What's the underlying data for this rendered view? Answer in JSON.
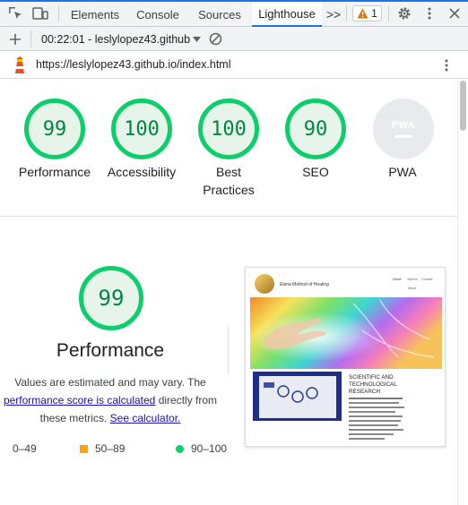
{
  "devtools": {
    "tabs": [
      "Elements",
      "Console",
      "Sources",
      "Lighthouse"
    ],
    "active_tab": "Lighthouse",
    "more_tabs": ">>",
    "warning_count": "1"
  },
  "toolbar": {
    "report_label": "00:22:01 - leslylopez43.github"
  },
  "url": "https://leslylopez43.github.io/index.html",
  "scores": [
    {
      "label": "Performance",
      "score": "99"
    },
    {
      "label": "Accessibility",
      "score": "100"
    },
    {
      "label": "Best",
      "label2": "Practices",
      "score": "100"
    },
    {
      "label": "SEO",
      "score": "90"
    },
    {
      "label": "PWA",
      "score": "PWA"
    }
  ],
  "performance": {
    "score": "99",
    "title": "Performance",
    "desc_line1": "Values are estimated and may vary. The",
    "desc_link1": "performance score is calculated",
    "desc_mid": "directly from",
    "desc_line3": "these metrics.",
    "desc_link2": "See calculator."
  },
  "legend": [
    {
      "range": "0–49",
      "color": "#ff4e42"
    },
    {
      "range": "50–89",
      "color": "#ffa400"
    },
    {
      "range": "90–100",
      "color": "#0cce6b"
    }
  ],
  "screenshot": {
    "site_title": "Elena Method of Healing",
    "nav": [
      "Home",
      "Warrior",
      "Contact",
      "About"
    ],
    "heading": "SCIENTIFIC AND TECHNOLOGICAL RESEARCH",
    "body": "The Foundation seeks to directly and indirectly supporting the scientific and technological research carried out by Grigori Grabovoi and spreading the scientific discoveries and technological devices of Grigori Grabovoi at international level. PRK-1U – a device for the development of consciousness for eternal life – is currently available, also in the variant developed for medical entities."
  },
  "colors": {
    "good": "#0cce6b",
    "good_text": "#018642",
    "accent": "#1a73e8",
    "link": "#1a0dab"
  }
}
